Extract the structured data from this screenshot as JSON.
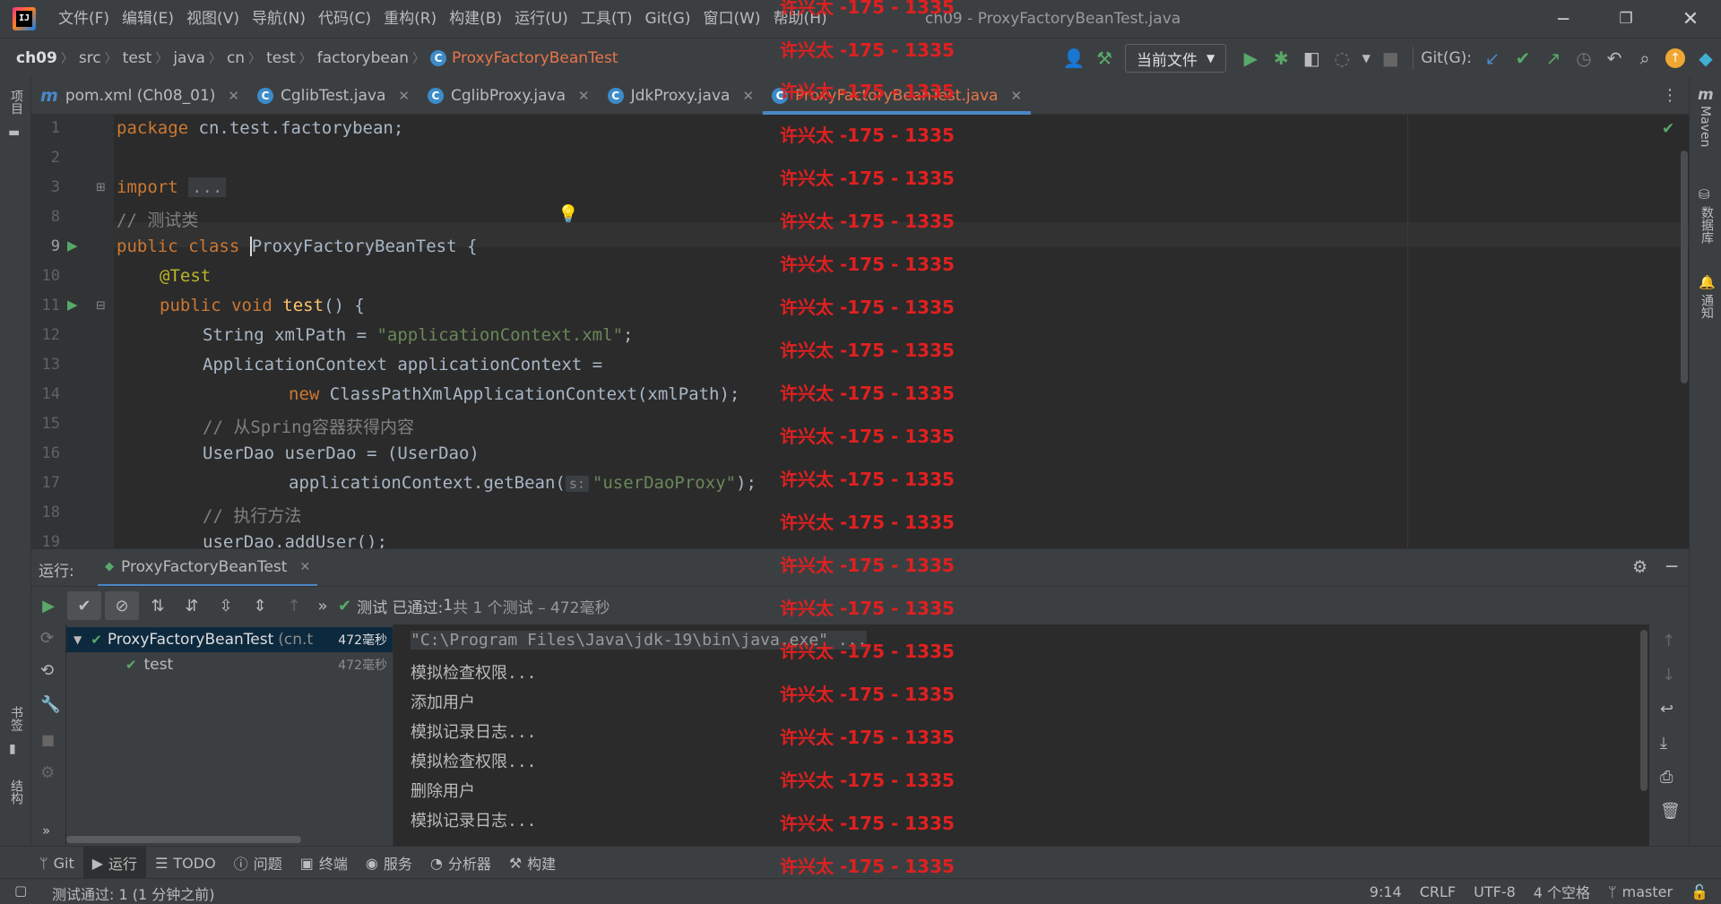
{
  "menu": [
    "文件(F)",
    "编辑(E)",
    "视图(V)",
    "导航(N)",
    "代码(C)",
    "重构(R)",
    "构建(B)",
    "运行(U)",
    "工具(T)",
    "Git(G)",
    "窗口(W)",
    "帮助(H)"
  ],
  "window_title": "ch09 - ProxyFactoryBeanTest.java",
  "breadcrumb": {
    "project": "ch09",
    "parts": [
      "src",
      "test",
      "java",
      "cn",
      "test",
      "factorybean"
    ],
    "file": "ProxyFactoryBeanTest"
  },
  "run_config": "当前文件",
  "git_label": "Git(G):",
  "tabs": [
    {
      "label": "pom.xml (Ch08_01)",
      "icon": "maven-icon"
    },
    {
      "label": "CglibTest.java",
      "icon": "java-class-icon"
    },
    {
      "label": "CglibProxy.java",
      "icon": "java-class-icon"
    },
    {
      "label": "JdkProxy.java",
      "icon": "java-class-icon"
    },
    {
      "label": "ProxyFactoryBeanTest.java",
      "icon": "java-class-icon"
    }
  ],
  "left_strip": {
    "project": "项目",
    "bookmarks": "书签",
    "structure": "结构"
  },
  "right_strip": {
    "maven": "Maven",
    "database": "数据库",
    "notifications": "通知"
  },
  "code": {
    "line_numbers": [
      "1",
      "2",
      "3",
      "8",
      "9",
      "10",
      "11",
      "12",
      "13",
      "14",
      "15",
      "16",
      "17",
      "18",
      "19"
    ],
    "l1_kw": "package",
    "l1_rest": " cn.test.factorybean;",
    "l3_kw": "import",
    "l3_fold": "...",
    "l8": "// 测试类",
    "l9_kw": "public class",
    "l9_name": "ProxyFactoryBeanTest",
    "l9_rest": " {",
    "l10": "@Test",
    "l11_kw": "public void",
    "l11_fn": "test",
    "l11_rest": "() {",
    "l12_a": "String xmlPath = ",
    "l12_str": "\"applicationContext.xml\"",
    "l12_b": ";",
    "l13": "ApplicationContext applicationContext =",
    "l14_kw": "new",
    "l14_rest": " ClassPathXmlApplicationContext(xmlPath);",
    "l15": "// 从Spring容器获得内容",
    "l16": "UserDao userDao = (UserDao)",
    "l17_a": "applicationContext.getBean(",
    "l17_hint": "s:",
    "l17_str": "\"userDaoProxy\"",
    "l17_b": ");",
    "l18": "// 执行方法",
    "l19": "userDao.addUser();"
  },
  "run": {
    "label": "运行:",
    "tab": "ProxyFactoryBeanTest",
    "status_prefix": "测试 已通过: ",
    "status_count": "1",
    "status_rest": "共 1 个测试 – 472毫秒",
    "tree": [
      {
        "name": "ProxyFactoryBeanTest",
        "suffix": "(cn.t",
        "time": "472毫秒"
      },
      {
        "name": "test",
        "time": "472毫秒"
      }
    ],
    "console": [
      "\"C:\\Program Files\\Java\\jdk-19\\bin\\java.exe\" ...",
      "模拟检查权限...",
      "添加用户",
      "模拟记录日志...",
      "模拟检查权限...",
      "删除用户",
      "模拟记录日志..."
    ]
  },
  "tool_windows": [
    "Git",
    "运行",
    "TODO",
    "问题",
    "终端",
    "服务",
    "分析器",
    "构建"
  ],
  "status": {
    "message": "测试通过: 1 (1 分钟之前)",
    "position": "9:14",
    "line_sep": "CRLF",
    "encoding": "UTF-8",
    "indent": "4 个空格",
    "branch": "master"
  },
  "watermark": "许兴太 -175 - 1335",
  "colors": {
    "accent": "#4a88c7",
    "active_tab": "#e8754a",
    "pass": "#59a869",
    "watermark": "#e02020"
  }
}
